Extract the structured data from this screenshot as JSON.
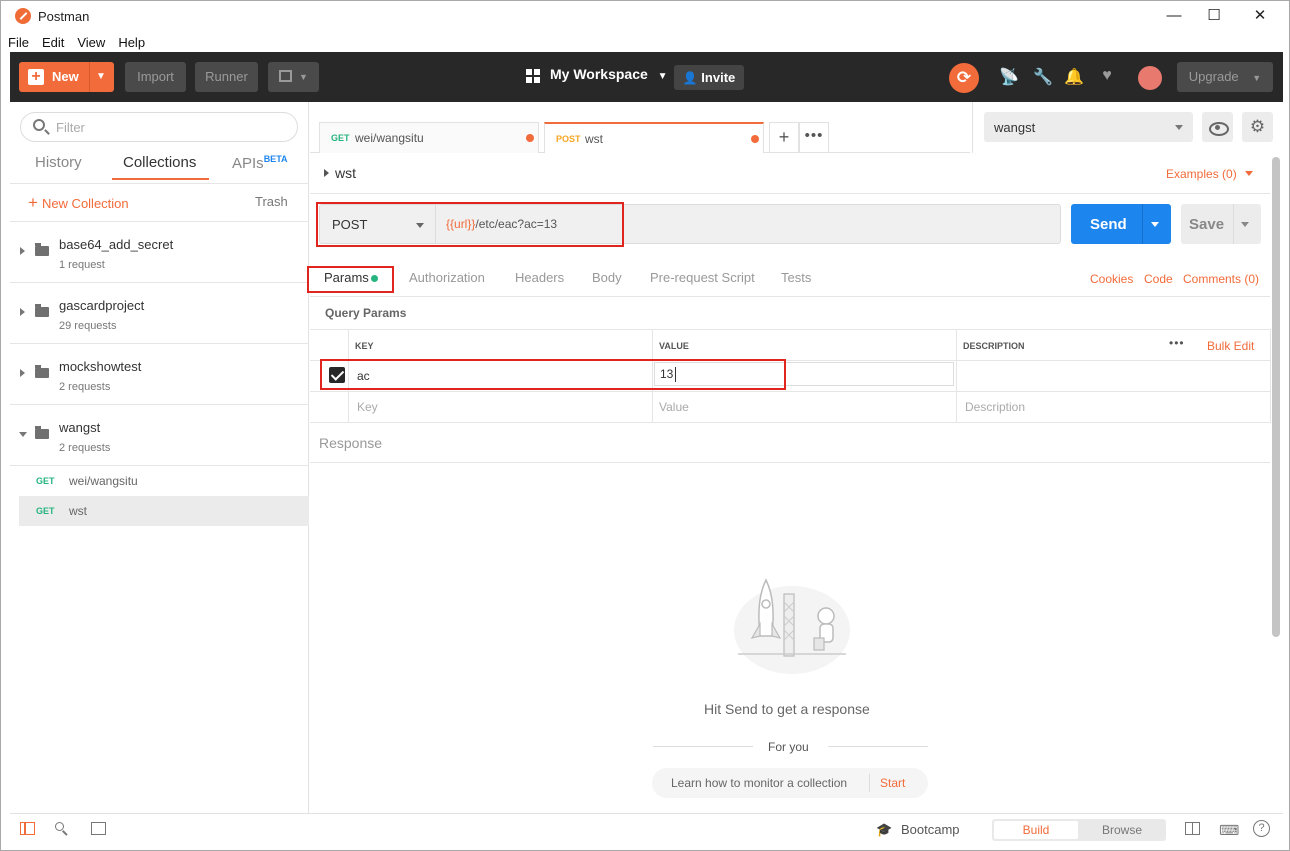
{
  "window": {
    "title": "Postman",
    "minimize": "—",
    "maximize": "☐",
    "close": "✕"
  },
  "menu": [
    "File",
    "Edit",
    "View",
    "Help"
  ],
  "header": {
    "new_label": "New",
    "import_label": "Import",
    "runner_label": "Runner",
    "workspace_label": "My Workspace",
    "invite_label": "Invite",
    "upgrade_label": "Upgrade"
  },
  "sidebar": {
    "filter_placeholder": "Filter",
    "tabs": {
      "history": "History",
      "collections": "Collections",
      "apis": "APIs",
      "apis_badge": "BETA"
    },
    "new_collection_label": "New Collection",
    "trash_label": "Trash",
    "collections": [
      {
        "name": "base64_add_secret",
        "count": "1 request"
      },
      {
        "name": "gascardproject",
        "count": "29 requests"
      },
      {
        "name": "mockshowtest",
        "count": "2 requests"
      },
      {
        "name": "wangst",
        "count": "2 requests"
      }
    ],
    "requests": [
      {
        "method": "GET",
        "name": "wei/wangsitu"
      },
      {
        "method": "GET",
        "name": "wst"
      }
    ]
  },
  "tabs": [
    {
      "method": "GET",
      "name": "wei/wangsitu",
      "method_color": "#26b47f"
    },
    {
      "method": "POST",
      "name": "wst",
      "method_color": "#f5a623"
    }
  ],
  "environment": {
    "selected": "wangst"
  },
  "request": {
    "name": "wst",
    "examples_label": "Examples (0)",
    "method": "POST",
    "url_var": "{{url}}",
    "url_path": "/etc/eac?ac=13",
    "send_label": "Send",
    "save_label": "Save"
  },
  "request_tabs": [
    "Params",
    "Authorization",
    "Headers",
    "Body",
    "Pre-request Script",
    "Tests"
  ],
  "right_links": [
    "Cookies",
    "Code",
    "Comments (0)"
  ],
  "params": {
    "title": "Query Params",
    "headers": {
      "key": "KEY",
      "value": "VALUE",
      "description": "DESCRIPTION"
    },
    "more": "•••",
    "bulk_edit": "Bulk Edit",
    "rows": [
      {
        "key": "ac",
        "value": "13"
      }
    ],
    "placeholders": {
      "key": "Key",
      "value": "Value",
      "description": "Description"
    }
  },
  "response": {
    "title": "Response",
    "hint": "Hit Send to get a response",
    "for_you": "For you",
    "learn": "Learn how to monitor a collection",
    "start": "Start"
  },
  "status": {
    "bootcamp": "Bootcamp",
    "build": "Build",
    "browse": "Browse"
  },
  "colors": {
    "accent": "#f26b3a",
    "send": "#1c86ee",
    "header_bg": "#282828",
    "highlight": "#e0251f"
  }
}
